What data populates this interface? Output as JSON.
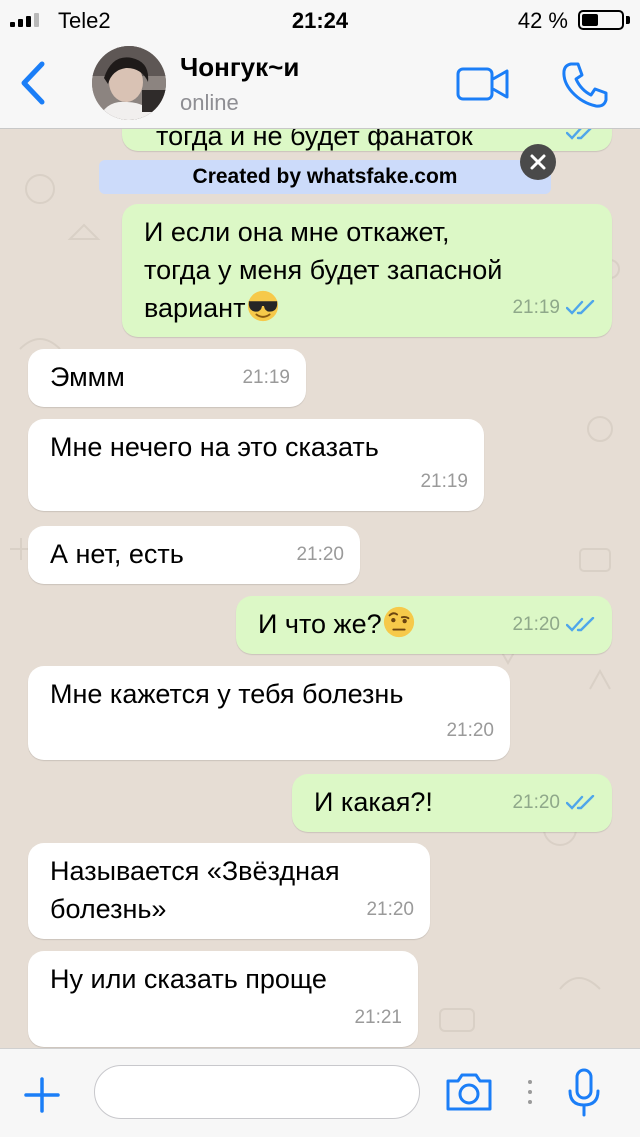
{
  "status_bar": {
    "carrier": "Tele2",
    "time": "21:24",
    "battery": "42 %",
    "battery_level": 0.42
  },
  "header": {
    "contact_name": "Чонгук~и",
    "contact_status": "online"
  },
  "watermark": {
    "text": "Created by whatsfake.com"
  },
  "partial_message": {
    "text": "тогда и не будет фанаток"
  },
  "messages": [
    {
      "direction": "out",
      "text": "И если она мне откажет,\nтогда у меня будет запасной\nвариант",
      "emoji": "sunglasses-emoji",
      "time": "21:19",
      "read": true
    },
    {
      "direction": "in",
      "text": "Эммм",
      "time": "21:19"
    },
    {
      "direction": "in",
      "text": "Мне нечего на это сказать",
      "time": "21:19"
    },
    {
      "direction": "in",
      "text": "А нет, есть",
      "time": "21:20"
    },
    {
      "direction": "out",
      "text": "И что же?",
      "emoji": "raised-eyebrow-emoji",
      "time": "21:20",
      "read": true
    },
    {
      "direction": "in",
      "text": "Мне кажется у тебя болезнь",
      "time": "21:20"
    },
    {
      "direction": "out",
      "text": "И какая?!",
      "time": "21:20",
      "read": true
    },
    {
      "direction": "in",
      "text": "Называется «Звёздная\nболезнь»",
      "time": "21:20"
    },
    {
      "direction": "in",
      "text": "Ну или сказать проще",
      "time": "21:21"
    }
  ],
  "input_bar": {
    "placeholder": ""
  },
  "colors": {
    "accent": "#1b7ef7",
    "incoming_bubble": "#ffffff",
    "outgoing_bubble": "#dcf8c6",
    "read_ticks": "#4fa6ea",
    "wallpaper": "#e6ddd4"
  }
}
